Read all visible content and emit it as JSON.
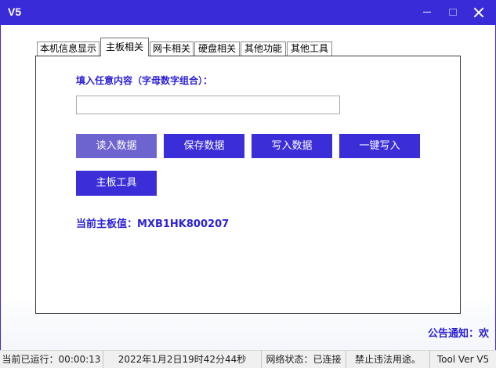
{
  "window": {
    "title": "V5"
  },
  "icons": {
    "minimize": "minimize-icon",
    "maximize": "maximize-icon",
    "close": "close-icon"
  },
  "tabs": [
    {
      "label": "本机信息显示",
      "selected": false
    },
    {
      "label": "主板相关",
      "selected": true
    },
    {
      "label": "网卡相关",
      "selected": false
    },
    {
      "label": "硬盘相关",
      "selected": false
    },
    {
      "label": "其他功能",
      "selected": false
    },
    {
      "label": "其他工具",
      "selected": false
    }
  ],
  "panel": {
    "input_label": "填入任意内容（字母数字组合）：",
    "input_value": "",
    "buttons": [
      {
        "label": "读入数据"
      },
      {
        "label": "保存数据"
      },
      {
        "label": "写入数据"
      },
      {
        "label": "一键写入"
      }
    ],
    "tool_button": "主板工具",
    "current_value_label": "当前主板值：",
    "current_value": "MXB1HK800207"
  },
  "notice": {
    "text": "公告通知：欢"
  },
  "status": {
    "runtime": "当前已运行：00:00:13",
    "datetime": "2022年1月2日19时42分44秒",
    "network": "网络状态：已连接",
    "warning": "禁止违法用途。",
    "version": "Tool Ver V5"
  },
  "colors": {
    "accent": "#3a2bd8",
    "button": "#3b2ed9",
    "button_hover": "#6e64cf",
    "label_text": "#2d22d6",
    "statusbar_bg": "#f0f0f0"
  }
}
